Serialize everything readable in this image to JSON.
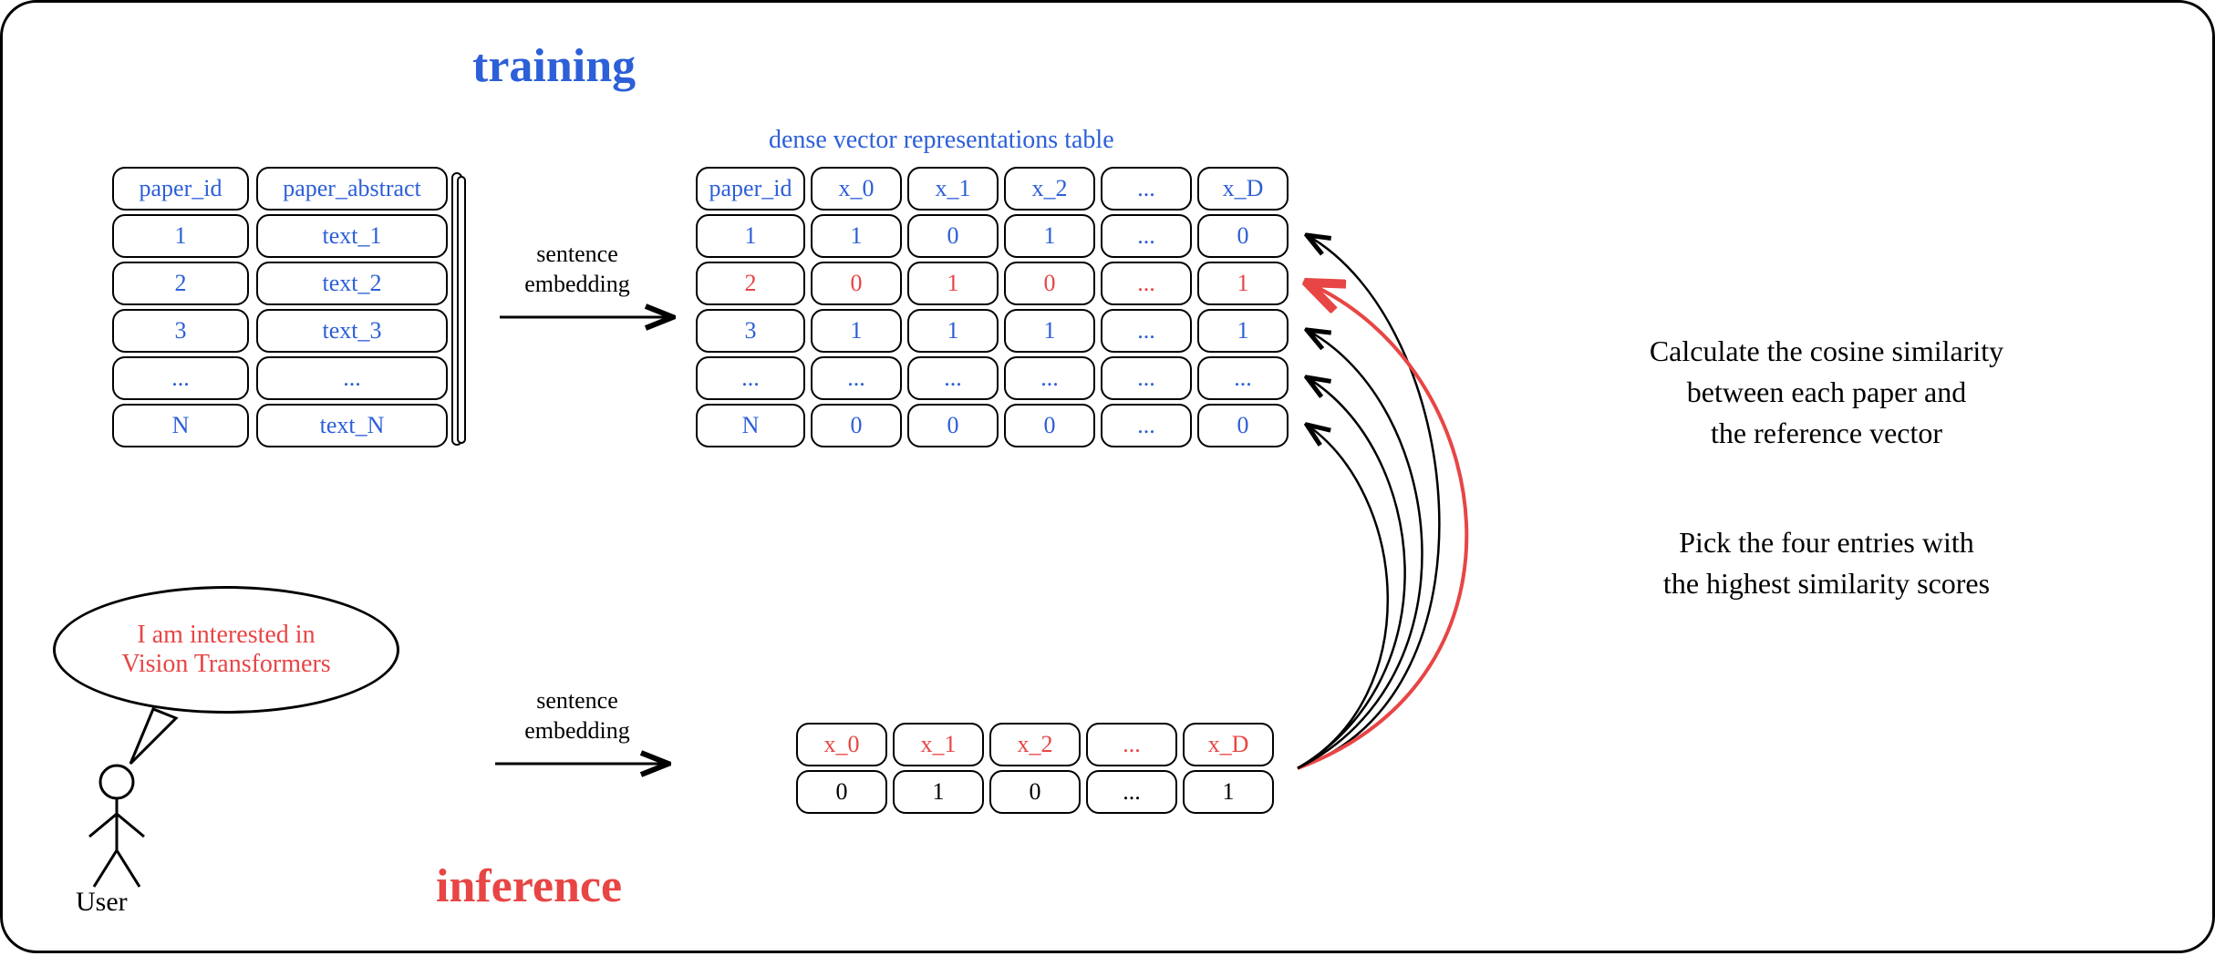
{
  "titles": {
    "training": "training",
    "inference": "inference",
    "dense_table": "dense vector representations table"
  },
  "source_table": {
    "headers": [
      "paper_id",
      "paper_abstract"
    ],
    "rows": [
      [
        "1",
        "text_1"
      ],
      [
        "2",
        "text_2"
      ],
      [
        "3",
        "text_3"
      ],
      [
        "...",
        "..."
      ],
      [
        "N",
        "text_N"
      ]
    ]
  },
  "vector_table": {
    "headers": [
      "paper_id",
      "x_0",
      "x_1",
      "x_2",
      "...",
      "x_D"
    ],
    "rows": [
      {
        "values": [
          "1",
          "1",
          "0",
          "1",
          "...",
          "0"
        ],
        "highlight": false
      },
      {
        "values": [
          "2",
          "0",
          "1",
          "0",
          "...",
          "1"
        ],
        "highlight": true
      },
      {
        "values": [
          "3",
          "1",
          "1",
          "1",
          "...",
          "1"
        ],
        "highlight": false
      },
      {
        "values": [
          "...",
          "...",
          "...",
          "...",
          "...",
          "..."
        ],
        "highlight": false
      },
      {
        "values": [
          "N",
          "0",
          "0",
          "0",
          "...",
          "0"
        ],
        "highlight": false
      }
    ]
  },
  "query_vector": {
    "headers": [
      "x_0",
      "x_1",
      "x_2",
      "...",
      "x_D"
    ],
    "values": [
      "0",
      "1",
      "0",
      "...",
      "1"
    ]
  },
  "arrow_labels": {
    "embedding1": "sentence\nembedding",
    "embedding2": "sentence\nembedding"
  },
  "description": {
    "line1": "Calculate the cosine similarity\nbetween each paper and\nthe reference vector",
    "line2": "Pick the four entries with\nthe highest similarity scores"
  },
  "user": {
    "speech": "I am interested in\nVision Transformers",
    "label": "User"
  }
}
